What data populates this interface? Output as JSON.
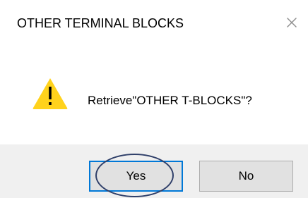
{
  "dialog": {
    "title": "OTHER TERMINAL BLOCKS",
    "close_icon": "close-icon",
    "message": "Retrieve\"OTHER T-BLOCKS\"?",
    "icon": "warning-icon",
    "buttons": {
      "yes_label": "Yes",
      "no_label": "No"
    },
    "colors": {
      "warning_yellow": "#ffd21c",
      "warning_mark": "#000000",
      "focus_border": "#0078d7",
      "highlight_oval": "#30406a",
      "button_strip": "#f0f0f0"
    }
  }
}
